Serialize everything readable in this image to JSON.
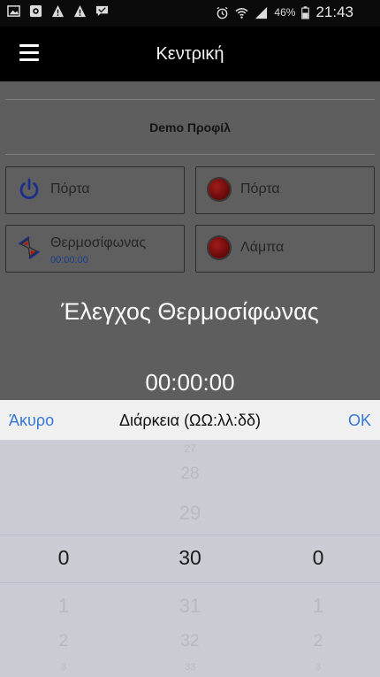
{
  "status_bar": {
    "battery": "46%",
    "time": "21:43",
    "left_icons": [
      "image-icon",
      "screenshot-icon",
      "warning-icon",
      "warning-icon",
      "message-icon"
    ],
    "right_icons": [
      "alarm-icon",
      "wifi-icon",
      "signal-icon",
      "battery-icon"
    ]
  },
  "app_bar": {
    "title": "Κεντρική"
  },
  "profile": {
    "title": "Demo Προφίλ"
  },
  "tiles": [
    {
      "label": "Πόρτα",
      "icon": "power-icon"
    },
    {
      "label": "Πόρτα",
      "icon": "red-indicator-icon"
    },
    {
      "label": "Θερμοσίφωνας",
      "sublabel": "00:00:00",
      "icon": "hourglass-icon"
    },
    {
      "label": "Λάμπα",
      "icon": "red-indicator-icon"
    }
  ],
  "dialog": {
    "title": "Έλεγχος Θερμοσίφωνας",
    "time": "00:00:00"
  },
  "picker": {
    "cancel_label": "Άκυρο",
    "label": "Διάρκεια (ΩΩ:λλ:δδ)",
    "ok_label": "OK",
    "hours": {
      "above": [],
      "selected": "0",
      "below": [
        "1",
        "2",
        "3"
      ]
    },
    "minutes": {
      "above": [
        "27",
        "28",
        "29"
      ],
      "selected": "30",
      "below": [
        "31",
        "32",
        "33"
      ]
    },
    "seconds": {
      "above": [],
      "selected": "0",
      "below": [
        "1",
        "2",
        "3"
      ]
    }
  },
  "colors": {
    "accent": "#3478d4",
    "appbar": "#000000",
    "overlay": "#5e5e5e"
  }
}
